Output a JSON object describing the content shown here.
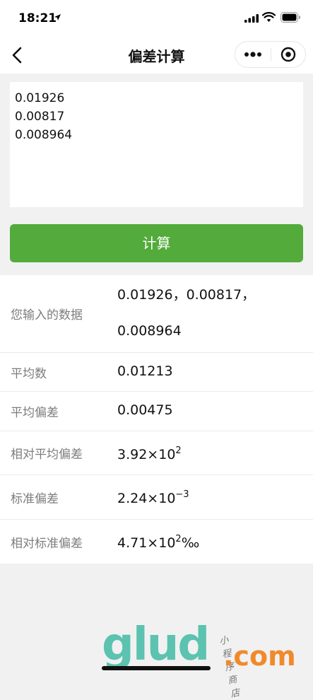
{
  "status_bar": {
    "time": "18:21"
  },
  "nav": {
    "title": "偏差计算"
  },
  "input": {
    "value": "0.01926\n0.00817\n0.008964"
  },
  "calculate_label": "计算",
  "results": {
    "input_data": {
      "label": "您输入的数据",
      "line1": "0.01926，0.00817，",
      "line2": "0.008964"
    },
    "mean": {
      "label": "平均数",
      "value": "0.01213"
    },
    "mean_deviation": {
      "label": "平均偏差",
      "value": "0.00475"
    },
    "relative_mean_deviation": {
      "label": "相对平均偏差",
      "mantissa": "3.92×10",
      "exponent": "2",
      "suffix": ""
    },
    "standard_deviation": {
      "label": "标准偏差",
      "mantissa": "2.24×10",
      "exponent": "−3",
      "suffix": ""
    },
    "relative_standard_deviation": {
      "label": "相对标准偏差",
      "mantissa": "4.71×10",
      "exponent": "2",
      "suffix": "‰"
    }
  },
  "watermark": {
    "logo": "glud",
    "domain": ".com",
    "tagline": "小程序商店"
  },
  "colors": {
    "accent_green": "#52ab3a",
    "background": "#f1f1f1"
  }
}
